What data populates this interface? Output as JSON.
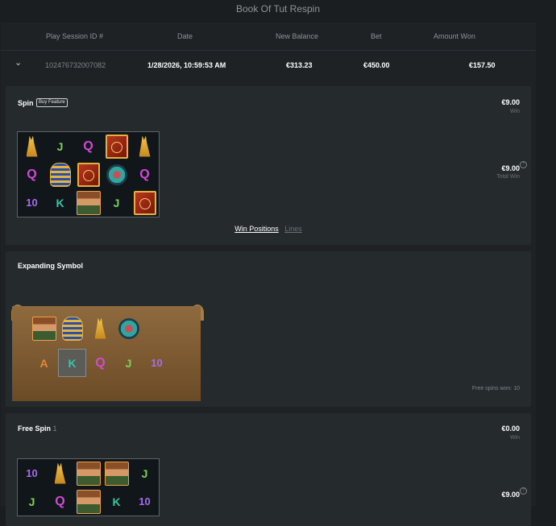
{
  "window_title": "Book Of Tut Respin",
  "table": {
    "headers": [
      "Play Session ID #",
      "Date",
      "New Balance",
      "Bet",
      "Amount Won"
    ],
    "row": {
      "session_id": "102476732007082",
      "date": "1/28/2026, 10:59:53 AM",
      "new_balance": "€313.23",
      "bet": "€450.00",
      "amount_won": "€157.50"
    }
  },
  "spin": {
    "title": "Spin",
    "badge": "Buy Feature",
    "win_amount": "€9.00",
    "win_label": "Win",
    "total_win_amount": "€9.00",
    "total_win_label": "Total Win",
    "grid": [
      [
        "cat-icon",
        "J",
        "Q",
        "book-icon",
        "cat-icon"
      ],
      [
        "Q",
        "pharaoh-icon",
        "book-icon",
        "scarab-icon",
        "Q"
      ],
      [
        "10",
        "K",
        "explorer-icon",
        "J",
        "book-icon"
      ]
    ],
    "tabs": [
      "Win Positions",
      "Lines"
    ]
  },
  "expanding": {
    "title": "Expanding Symbol",
    "symbols": [
      [
        "explorer-icon",
        "pharaoh-icon",
        "cat-icon",
        "scarab-icon"
      ],
      [
        "A",
        "K",
        "Q",
        "J",
        "10"
      ]
    ],
    "selected": "K",
    "note": "Free spins won: 10"
  },
  "free_spin": {
    "title": "Free Spin",
    "number": "1",
    "win_amount": "€0.00",
    "win_label": "Win",
    "total_win_amount": "€9.00",
    "grid": [
      [
        "10",
        "cat-icon",
        "explorer-icon",
        "explorer-icon",
        "J"
      ],
      [
        "J",
        "Q",
        "explorer-icon",
        "K",
        "10"
      ]
    ]
  }
}
